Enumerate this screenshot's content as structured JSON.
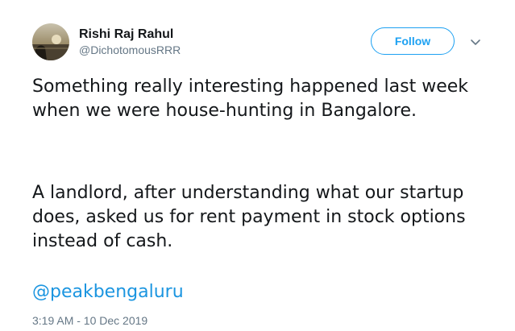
{
  "tweet": {
    "author": {
      "display_name": "Rishi Raj Rahul",
      "handle": "@DichotomousRRR"
    },
    "follow_label": "Follow",
    "paragraphs": [
      "Something really interesting happened last week when we were house-hunting in Bangalore.",
      "A landlord, after understanding what our startup does, asked us for rent payment in stock options instead of cash."
    ],
    "mention": "@peakbengaluru",
    "timestamp": "3:19 AM - 10 Dec 2019"
  },
  "colors": {
    "accent": "#1da1f2",
    "link": "#1b95e0",
    "text": "#14171a",
    "muted": "#657786"
  },
  "icons": {
    "avatar": "profile-photo",
    "caret": "chevron-down-icon"
  }
}
